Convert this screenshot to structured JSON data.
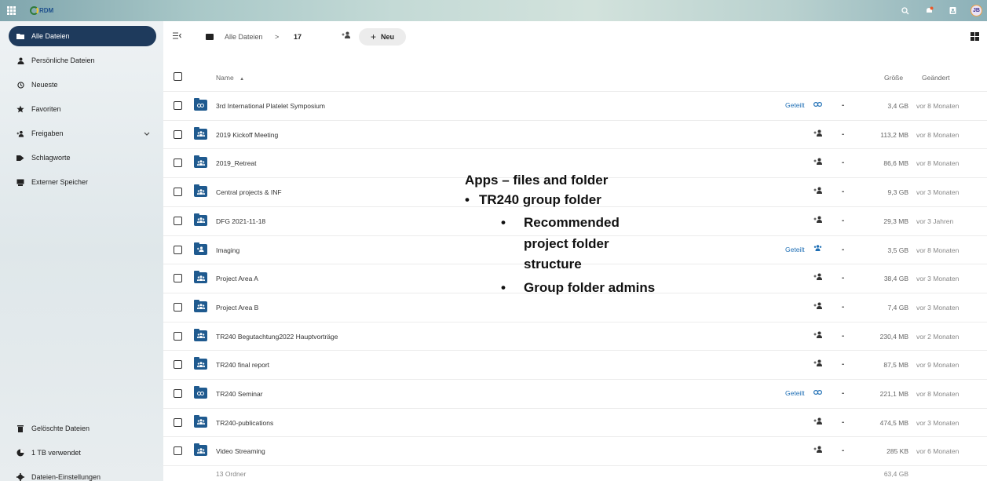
{
  "header": {
    "logo_text": "RDM",
    "avatar_initials": "JB",
    "icons": [
      "apps-icon",
      "search-icon",
      "notifications-icon",
      "contacts-icon",
      "avatar"
    ]
  },
  "sidebar": {
    "items": [
      {
        "label": "Alle Dateien",
        "icon": "folder-icon",
        "active": true
      },
      {
        "label": "Persönliche Dateien",
        "icon": "person-icon"
      },
      {
        "label": "Neueste",
        "icon": "clock-icon"
      },
      {
        "label": "Favoriten",
        "icon": "star-icon"
      },
      {
        "label": "Freigaben",
        "icon": "share-icon",
        "expandable": true
      },
      {
        "label": "Schlagworte",
        "icon": "tag-icon"
      },
      {
        "label": "Externer Speicher",
        "icon": "external-storage-icon"
      }
    ],
    "bottom": [
      {
        "label": "Gelöschte Dateien",
        "icon": "trash-icon"
      },
      {
        "label": "1 TB verwendet",
        "icon": "pie-chart-icon"
      },
      {
        "label": "Dateien-Einstellungen",
        "icon": "gear-icon"
      }
    ]
  },
  "toolbar": {
    "breadcrumb_root": "Alle Dateien",
    "breadcrumb_sep": ">",
    "breadcrumb_current": "17",
    "new_label": "Neu"
  },
  "table": {
    "col_name": "Name",
    "sort_indicator": "▲",
    "col_size": "Größe",
    "col_modified": "Geändert",
    "rows": [
      {
        "name": "3rd International Platelet Symposium",
        "folder_type": "link",
        "shared": "Geteilt",
        "size": "3,4 GB",
        "modified": "vor 8 Monaten"
      },
      {
        "name": "2019 Kickoff Meeting",
        "folder_type": "group",
        "shared": "",
        "size": "113,2 MB",
        "modified": "vor 8 Monaten"
      },
      {
        "name": "2019_Retreat",
        "folder_type": "group",
        "shared": "",
        "size": "86,6 MB",
        "modified": "vor 8 Monaten"
      },
      {
        "name": "Central projects & INF",
        "folder_type": "group",
        "shared": "",
        "size": "9,3 GB",
        "modified": "vor 3 Monaten"
      },
      {
        "name": "DFG 2021-11-18",
        "folder_type": "group",
        "shared": "",
        "size": "29,3 MB",
        "modified": "vor 3 Jahren"
      },
      {
        "name": "Imaging",
        "folder_type": "shared",
        "shared": "Geteilt",
        "size": "3,5 GB",
        "modified": "vor 8 Monaten"
      },
      {
        "name": "Project Area A",
        "folder_type": "group",
        "shared": "",
        "size": "38,4 GB",
        "modified": "vor 3 Monaten"
      },
      {
        "name": "Project Area B",
        "folder_type": "group",
        "shared": "",
        "size": "7,4 GB",
        "modified": "vor 3 Monaten"
      },
      {
        "name": "TR240 Begutachtung2022 Hauptvorträge",
        "folder_type": "group",
        "shared": "",
        "size": "230,4 MB",
        "modified": "vor 2 Monaten"
      },
      {
        "name": "TR240 final report",
        "folder_type": "group",
        "shared": "",
        "size": "87,5 MB",
        "modified": "vor 9 Monaten"
      },
      {
        "name": "TR240 Seminar",
        "folder_type": "link",
        "shared": "Geteilt",
        "size": "221,1 MB",
        "modified": "vor 8 Monaten"
      },
      {
        "name": "TR240-publications",
        "folder_type": "group",
        "shared": "",
        "size": "474,5 MB",
        "modified": "vor 3 Monaten"
      },
      {
        "name": "Video Streaming",
        "folder_type": "group",
        "shared": "",
        "size": "285 KB",
        "modified": "vor 6 Monaten"
      }
    ],
    "summary_count": "13 Ordner",
    "summary_size": "63,4 GB"
  },
  "overlay": {
    "title": "Apps – files and folder",
    "line1": "TR240 group folder",
    "line2a": "Recommended",
    "line2b": "project folder",
    "line2c": "structure",
    "line3": "Group folder admins"
  },
  "colors": {
    "sidebar_active": "#1e3a5c",
    "folder_icon": "#1f5a8f",
    "shared_link": "#1f6fb5"
  }
}
